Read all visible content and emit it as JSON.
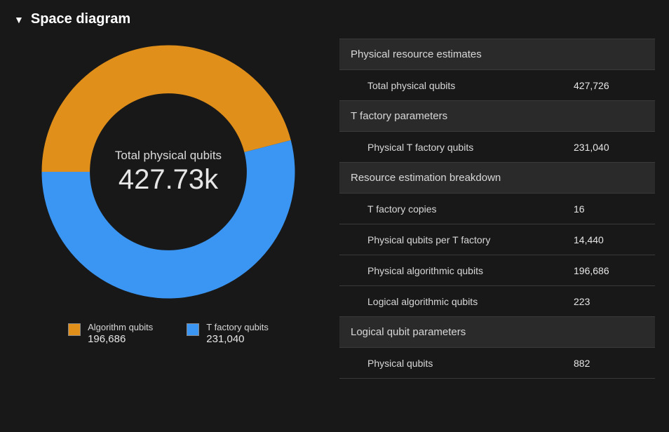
{
  "section_title": "Space diagram",
  "donut": {
    "center_label": "Total physical qubits",
    "center_value": "427.73k"
  },
  "legend": [
    {
      "name": "Algorithm qubits",
      "value": "196,686",
      "color": "#e08f1a"
    },
    {
      "name": "T factory qubits",
      "value": "231,040",
      "color": "#3a96f2"
    }
  ],
  "table": {
    "groups": [
      {
        "header": "Physical resource estimates",
        "rows": [
          {
            "label": "Total physical qubits",
            "value": "427,726"
          }
        ]
      },
      {
        "header": "T factory parameters",
        "rows": [
          {
            "label": "Physical T factory qubits",
            "value": "231,040"
          }
        ]
      },
      {
        "header": "Resource estimation breakdown",
        "rows": [
          {
            "label": "T factory copies",
            "value": "16"
          },
          {
            "label": "Physical qubits per T factory",
            "value": "14,440"
          },
          {
            "label": "Physical algorithmic qubits",
            "value": "196,686"
          },
          {
            "label": "Logical algorithmic qubits",
            "value": "223"
          }
        ]
      },
      {
        "header": "Logical qubit parameters",
        "rows": [
          {
            "label": "Physical qubits",
            "value": "882"
          }
        ]
      }
    ]
  },
  "chart_data": {
    "type": "pie",
    "title": "Space diagram",
    "center_label": "Total physical qubits",
    "total": 427726,
    "series": [
      {
        "name": "Algorithm qubits",
        "value": 196686,
        "color": "#e08f1a"
      },
      {
        "name": "T factory qubits",
        "value": 231040,
        "color": "#3a96f2"
      }
    ],
    "inner_radius_ratio": 0.62
  }
}
